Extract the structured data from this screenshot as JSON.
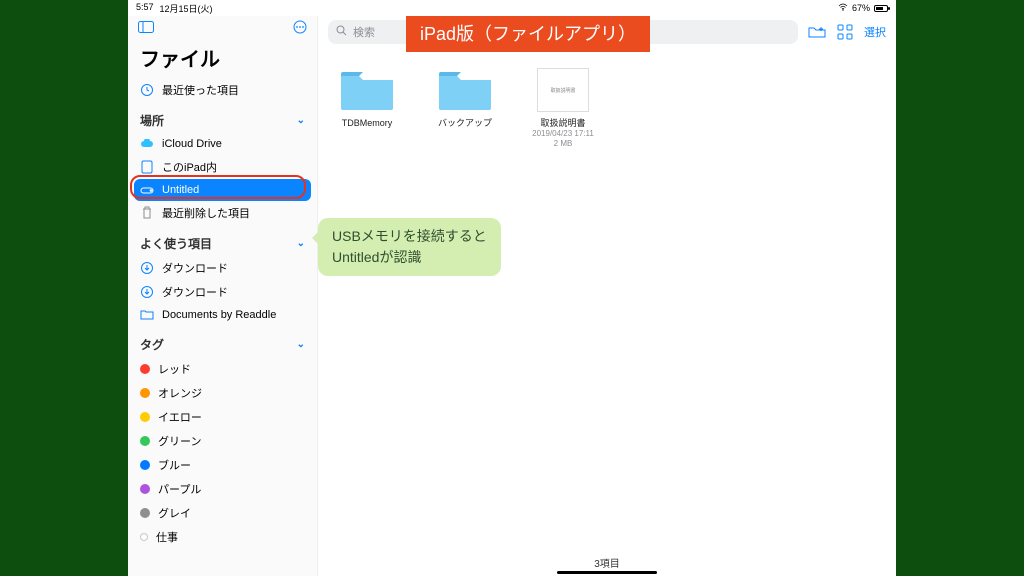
{
  "statusbar": {
    "time": "5:57",
    "date": "12月15日(火)",
    "battery": "67%"
  },
  "sidebar": {
    "title": "ファイル",
    "recent": {
      "label": "最近使った項目"
    },
    "sections": {
      "locations": {
        "header": "場所",
        "items": [
          {
            "label": "iCloud Drive"
          },
          {
            "label": "このiPad内"
          },
          {
            "label": "Untitled"
          },
          {
            "label": "最近削除した項目"
          }
        ]
      },
      "favorites": {
        "header": "よく使う項目",
        "items": [
          {
            "label": "ダウンロード"
          },
          {
            "label": "ダウンロード"
          },
          {
            "label": "Documents by Readdle"
          }
        ]
      },
      "tags": {
        "header": "タグ",
        "items": [
          {
            "label": "レッド",
            "color": "#ff3b30"
          },
          {
            "label": "オレンジ",
            "color": "#ff9500"
          },
          {
            "label": "イエロー",
            "color": "#ffcc00"
          },
          {
            "label": "グリーン",
            "color": "#34c759"
          },
          {
            "label": "ブルー",
            "color": "#007aff"
          },
          {
            "label": "パープル",
            "color": "#af52de"
          },
          {
            "label": "グレイ",
            "color": "#8e8e93"
          },
          {
            "label": "仕事",
            "color": "#d1d1d6"
          }
        ]
      }
    }
  },
  "toolbar": {
    "search_placeholder": "検索",
    "select_label": "選択"
  },
  "grid": {
    "items": [
      {
        "kind": "folder",
        "name": "TDBMemory"
      },
      {
        "kind": "folder",
        "name": "バックアップ"
      },
      {
        "kind": "doc",
        "name": "取扱説明書",
        "thumb_text": "取扱説明書",
        "date": "2019/04/23 17:11",
        "size": "2 MB"
      }
    ]
  },
  "footer": {
    "count": "3項目"
  },
  "overlays": {
    "banner": "iPad版（ファイルアプリ）",
    "callout_line1": "USBメモリを接続すると",
    "callout_line2": "Untitledが認識"
  },
  "colors": {
    "accent": "#0a84ff",
    "banner": "#ea4b1f",
    "callout": "#d4edb0",
    "ring": "#e53120"
  }
}
